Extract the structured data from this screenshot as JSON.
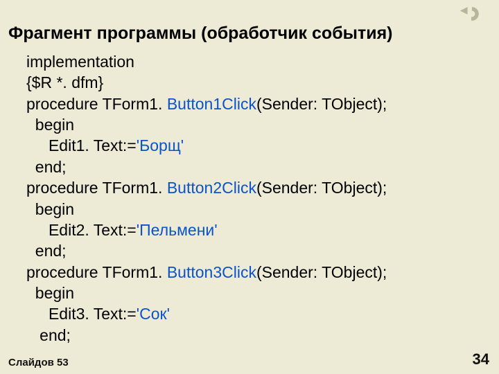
{
  "title": "Фрагмент программы (обработчик события)",
  "code": {
    "l1": "implementation",
    "l2": "{$R *. dfm}",
    "l3a": "procedure TForm1. ",
    "l3b": "Button1Click",
    "l3c": "(Sender: TObject);",
    "l4": "  begin",
    "l5a": "     Edit1. Text:=",
    "l5b": "'Борщ'",
    "l6": "  end;",
    "l7a": "procedure TForm1. ",
    "l7b": "Button2Click",
    "l7c": "(Sender: TObject);",
    "l8": "  begin",
    "l9a": "     Edit2. Text:=",
    "l9b": "'Пельмени'",
    "l10": "  end;",
    "l11a": "procedure TForm1. ",
    "l11b": "Button3Click",
    "l11c": "(Sender: TObject);",
    "l12": "  begin",
    "l13a": "     Edit3. Text:=",
    "l13b": "'Сок'",
    "l14": "   end;"
  },
  "footer": {
    "left": "Слайдов 53",
    "right": "34"
  },
  "colors": {
    "background": "#edead5",
    "keyword": "#0b53c8"
  }
}
